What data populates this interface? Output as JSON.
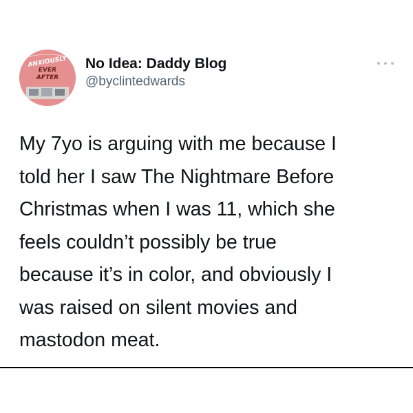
{
  "tweet": {
    "avatar_text": {
      "line1": "ANXIOUSLY",
      "line2": "EVER",
      "line3": "AFTER"
    },
    "display_name": "No Idea: Daddy Blog",
    "handle": "@byclintedwards",
    "more_icon": "more-horizontal-icon",
    "text": "My 7yo is arguing with me because I\ntold her I saw The Nightmare Before\nChristmas when I was 11, which she\nfeels couldn’t possibly be true\nbecause it’s in color, and obviously I\nwas raised on silent movies and\nmastodon meat."
  },
  "colors": {
    "text": "#0f1419",
    "secondary_text": "#536471",
    "avatar_bg": "#e58f90",
    "background": "#ffffff",
    "divider": "#000000"
  }
}
